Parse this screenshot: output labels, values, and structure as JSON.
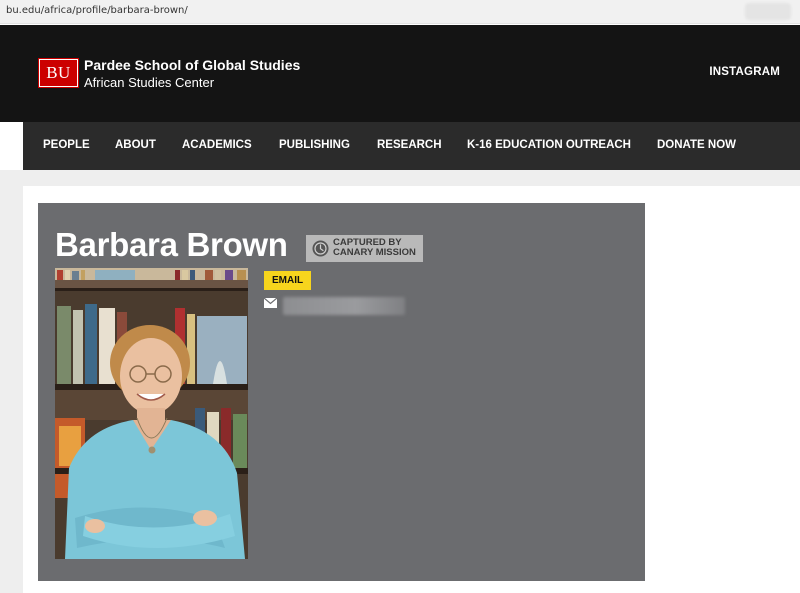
{
  "browser": {
    "url": "bu.edu/africa/profile/barbara-brown/"
  },
  "header": {
    "logo_text": "BU",
    "school_name": "Pardee School of Global Studies",
    "center_name": "African Studies Center",
    "instagram_label": "INSTAGRAM"
  },
  "nav": {
    "items": [
      {
        "label": "PEOPLE"
      },
      {
        "label": "ABOUT"
      },
      {
        "label": "ACADEMICS"
      },
      {
        "label": "PUBLISHING"
      },
      {
        "label": "RESEARCH"
      },
      {
        "label": "K-16 EDUCATION OUTREACH"
      },
      {
        "label": "DONATE NOW"
      }
    ]
  },
  "profile": {
    "name": "Barbara Brown",
    "canary_badge": "CAPTURED BY\nCANARY MISSION",
    "email_label": "EMAIL",
    "icons": [
      "clock-icon",
      "mail-icon"
    ],
    "colors": {
      "card_bg": "#6b6c6f",
      "email_badge": "#f7d51d",
      "logo_red": "#cc0000",
      "header_bg": "#141414",
      "nav_bg": "#2b2b2b"
    }
  }
}
